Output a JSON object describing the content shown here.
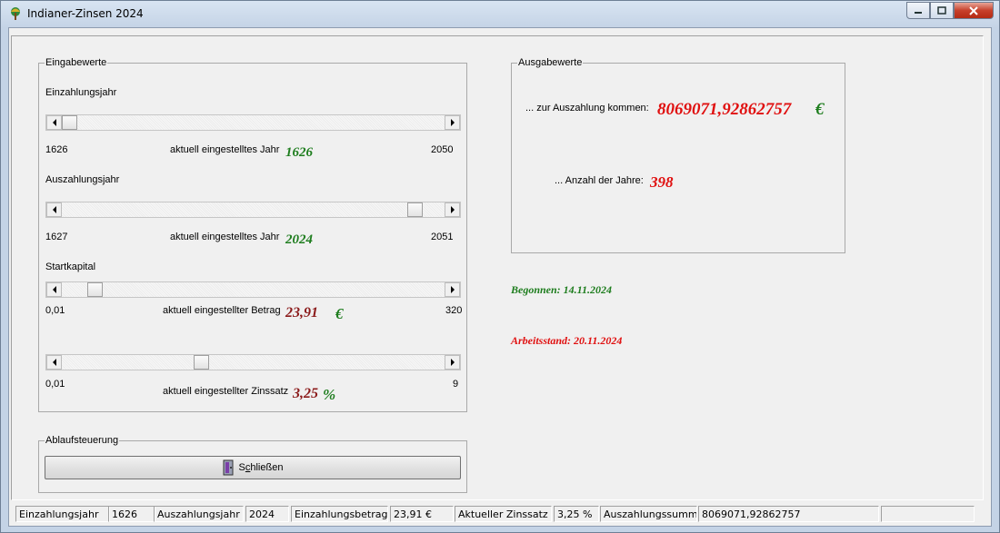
{
  "window": {
    "title": "Indianer-Zinsen 2024",
    "buttons": [
      "minimize",
      "maximize",
      "close"
    ]
  },
  "eingabe": {
    "group_label": "Eingabewerte",
    "einzahlungsjahr": {
      "label": "Einzahlungsjahr",
      "min": "1626",
      "max": "2050",
      "current_label": "aktuell eingestelltes Jahr",
      "value": "1626",
      "position_fraction": 0.0
    },
    "auszahlungsjahr": {
      "label": "Auszahlungsjahr",
      "min": "1627",
      "max": "2051",
      "current_label": "aktuell eingestelltes Jahr",
      "value": "2024",
      "position_fraction": 0.94
    },
    "startkapital": {
      "label": "Startkapital",
      "min": "0,01",
      "max": "320",
      "current_label": "aktuell eingestellter Betrag",
      "value": "23,91",
      "unit": "€",
      "position_fraction": 0.075
    },
    "zinssatz": {
      "min": "0,01",
      "max": "9",
      "current_label": "aktuell eingestellter Zinssatz",
      "value": "3,25",
      "unit": "%",
      "position_fraction": 0.36
    }
  },
  "ausgabe": {
    "group_label": "Ausgabewerte",
    "auszahlung_label": "... zur Auszahlung kommen:",
    "auszahlung_value": "8069071,92862757",
    "auszahlung_unit": "€",
    "jahre_label": "... Anzahl der Jahre:",
    "jahre_value": "398"
  },
  "begonnen": "Begonnen: 14.11.2024",
  "arbeitsstand": "Arbeitsstand: 20.11.2024",
  "ablauf": {
    "group_label": "Ablaufsteuerung",
    "close_label": "Schließen"
  },
  "statusbar": [
    "Einzahlungsjahr",
    "1626",
    "Auszahlungsjahr",
    "2024",
    "Einzahlungsbetrag",
    "23,91 €",
    "Aktueller Zinssatz",
    "3,25 %",
    "Auszahlungssumme",
    "8069071,92862757",
    ""
  ],
  "colors": {
    "green": "#1e7d1e",
    "red": "#e01010",
    "maroon": "#8b1b1b"
  }
}
